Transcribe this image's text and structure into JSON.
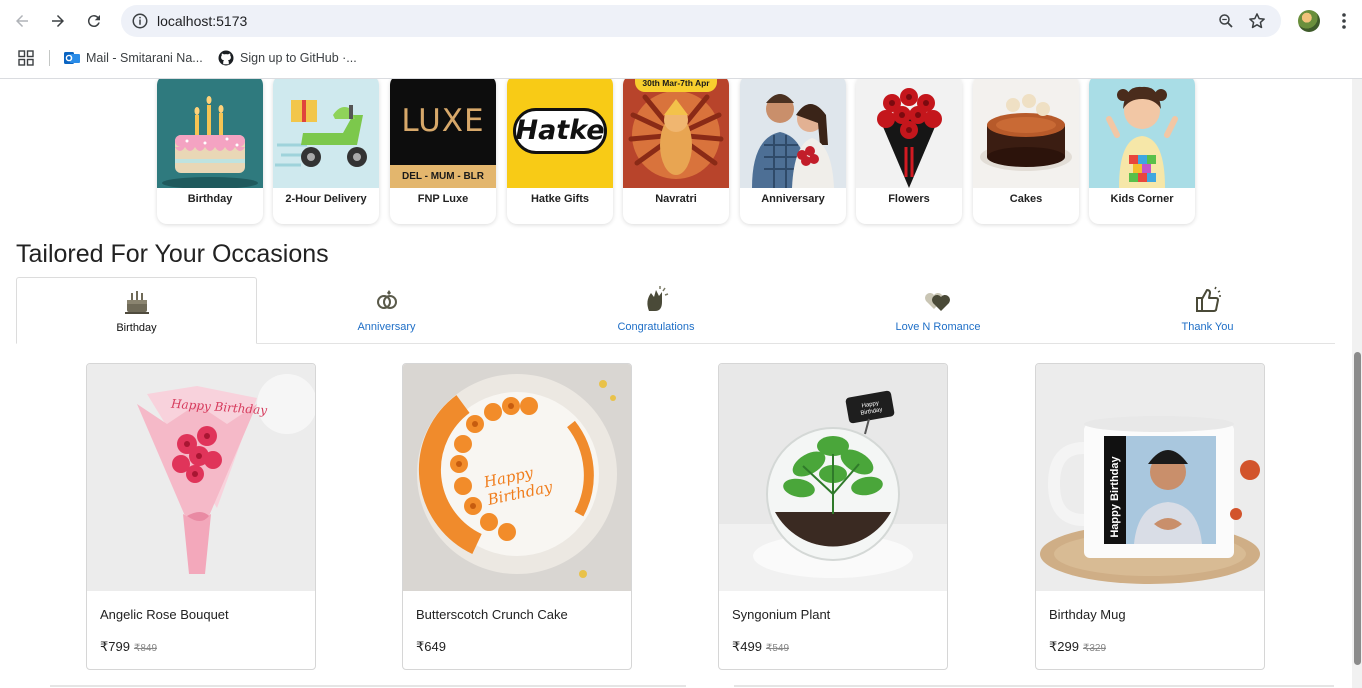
{
  "browser": {
    "url": "localhost:5173",
    "bookmarks": [
      {
        "label": "Mail - Smitarani Na..."
      },
      {
        "label": "Sign up to GitHub ·..."
      }
    ]
  },
  "categories": [
    {
      "label": "Birthday",
      "icon": "birthday-cake-icon"
    },
    {
      "label": "2-Hour Delivery",
      "icon": "scooter-icon"
    },
    {
      "label": "FNP Luxe",
      "icon": "luxe-logo",
      "logo_text": "LUXE",
      "logo_subtext": "DEL - MUM - BLR"
    },
    {
      "label": "Hatke Gifts",
      "icon": "hatke-logo",
      "logo_text": "Hatke"
    },
    {
      "label": "Navratri",
      "icon": "durga-icon",
      "banner": "30th Mar-7th Apr"
    },
    {
      "label": "Anniversary",
      "icon": "couple-icon"
    },
    {
      "label": "Flowers",
      "icon": "rose-bouquet-icon"
    },
    {
      "label": "Cakes",
      "icon": "chocolate-cake-icon"
    },
    {
      "label": "Kids Corner",
      "icon": "kid-icon"
    }
  ],
  "section": {
    "title": "Tailored For Your Occasions"
  },
  "occasion_tabs": [
    {
      "label": "Birthday",
      "icon": "cake-icon",
      "active": true
    },
    {
      "label": "Anniversary",
      "icon": "rings-icon",
      "active": false
    },
    {
      "label": "Congratulations",
      "icon": "clap-icon",
      "active": false
    },
    {
      "label": "Love N Romance",
      "icon": "hearts-icon",
      "active": false
    },
    {
      "label": "Thank You",
      "icon": "thumbs-up-icon",
      "active": false
    }
  ],
  "products": [
    {
      "name": "Angelic Rose Bouquet",
      "price": "₹799",
      "mrp": "₹849",
      "image": "pink-rose-bouquet",
      "image_text": "Happy Birthday"
    },
    {
      "name": "Butterscotch Crunch Cake",
      "price": "₹649",
      "mrp": "",
      "image": "butterscotch-cake",
      "image_text": "Happy Birthday"
    },
    {
      "name": "Syngonium Plant",
      "price": "₹499",
      "mrp": "₹549",
      "image": "terrarium-plant",
      "image_text": "Happy Birthday"
    },
    {
      "name": "Birthday Mug",
      "price": "₹299",
      "mrp": "₹329",
      "image": "photo-mug",
      "image_text": "Happy Birthday"
    }
  ]
}
